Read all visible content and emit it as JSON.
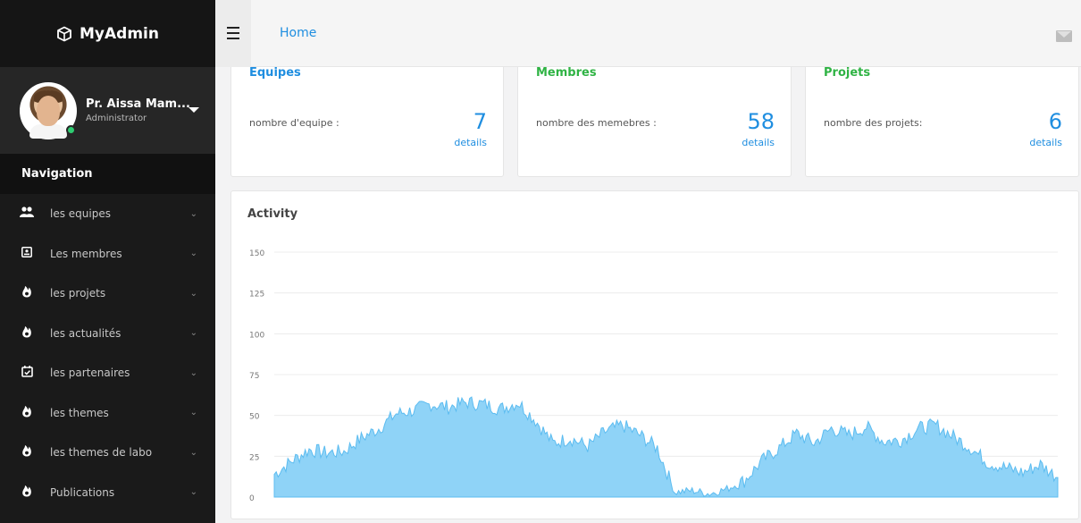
{
  "app": {
    "brand": "MyAdmin"
  },
  "profile": {
    "name": "Pr. Aissa Mam...",
    "role": "Administrator"
  },
  "sidebar": {
    "nav_title": "Navigation",
    "items": [
      {
        "label": "les equipes",
        "icon": "users-icon"
      },
      {
        "label": "Les membres",
        "icon": "id-card-icon"
      },
      {
        "label": "les projets",
        "icon": "flame-icon"
      },
      {
        "label": "les actualités",
        "icon": "flame-icon"
      },
      {
        "label": "les partenaires",
        "icon": "calendar-check-icon"
      },
      {
        "label": "les themes",
        "icon": "flame-icon"
      },
      {
        "label": "les themes de labo",
        "icon": "flame-icon"
      },
      {
        "label": "Publications",
        "icon": "flame-icon"
      }
    ]
  },
  "header": {
    "breadcrumb": "Home"
  },
  "stats": [
    {
      "title": "Equipes",
      "label": "nombre d'equipe :",
      "value": "7",
      "link": "details",
      "title_color": "#1f8ee0"
    },
    {
      "title": "Membres",
      "label": "nombre des memebres :",
      "value": "58",
      "link": "details",
      "title_color": "#2fb344"
    },
    {
      "title": "Projets",
      "label": "nombre des projets:",
      "value": "6",
      "link": "details",
      "title_color": "#2fb344"
    }
  ],
  "activity": {
    "title": "Activity"
  },
  "colors": {
    "accent": "#1f8ee0",
    "area_fill": "#8fd3f7",
    "area_stroke": "#5cbcf0"
  },
  "chart_data": {
    "type": "area",
    "title": "Activity",
    "ylim": [
      0,
      150
    ],
    "yticks": [
      0,
      25,
      50,
      75,
      100,
      125,
      150
    ],
    "grid": true,
    "x": [
      0,
      5,
      10,
      15,
      20,
      25,
      30,
      35,
      40,
      45,
      50,
      55,
      60,
      65,
      70,
      75,
      80,
      85,
      90,
      95,
      100,
      105,
      110,
      115,
      120,
      125,
      130,
      135,
      140,
      145,
      150,
      155,
      160,
      165,
      170,
      175,
      180,
      185,
      190,
      195,
      200
    ],
    "values": [
      14,
      22,
      29,
      27,
      28,
      36,
      42,
      51,
      53,
      57,
      55,
      58,
      57,
      54,
      58,
      47,
      33,
      36,
      31,
      40,
      44,
      38,
      30,
      3,
      4,
      2,
      5,
      10,
      22,
      30,
      39,
      33,
      42,
      38,
      43,
      34,
      35,
      42,
      44,
      37,
      30,
      21,
      18,
      15,
      20,
      12
    ]
  }
}
